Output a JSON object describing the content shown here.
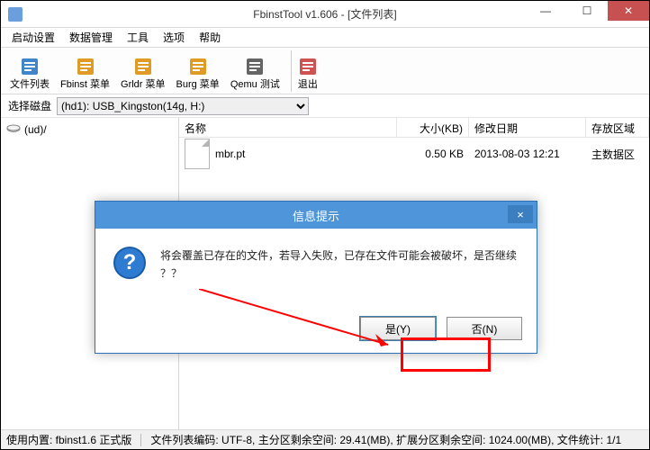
{
  "window": {
    "title": "FbinstTool v1.606 - [文件列表]"
  },
  "menu": {
    "items": [
      "启动设置",
      "数据管理",
      "工具",
      "选项",
      "帮助"
    ]
  },
  "toolbar": {
    "groups": [
      {
        "buttons": [
          {
            "label": "文件列表",
            "icon": "file-list-icon",
            "color": "#1e6fbf"
          },
          {
            "label": "Fbinst 菜单",
            "icon": "fbinst-menu-icon",
            "color": "#d98a00"
          },
          {
            "label": "Grldr 菜单",
            "icon": "grldr-menu-icon",
            "color": "#d98a00"
          },
          {
            "label": "Burg 菜单",
            "icon": "burg-menu-icon",
            "color": "#d98a00"
          },
          {
            "label": "Qemu 测试",
            "icon": "qemu-test-icon",
            "color": "#4a4a4a"
          }
        ]
      },
      {
        "buttons": [
          {
            "label": "退出",
            "icon": "exit-icon",
            "color": "#c73434"
          }
        ]
      }
    ]
  },
  "diskbar": {
    "label": "选择磁盘",
    "selected": "(hd1): USB_Kingston(14g, H:)"
  },
  "tree": {
    "root": "(ud)/"
  },
  "columns": {
    "name": "名称",
    "size": "大小(KB)",
    "date": "修改日期",
    "zone": "存放区域"
  },
  "files": [
    {
      "name": "mbr.pt",
      "size": "0.50 KB",
      "date": "2013-08-03 12:21",
      "zone": "主数据区"
    }
  ],
  "status": {
    "left": "使用内置: fbinst1.6 正式版",
    "right": "文件列表编码: UTF-8, 主分区剩余空间:   29.41(MB), 扩展分区剩余空间:   1024.00(MB), 文件统计: 1/1"
  },
  "dialog": {
    "title": "信息提示",
    "message": "将会覆盖已存在的文件，若导入失败，已存在文件可能会被破坏，是否继续 ？？",
    "yes": "是(Y)",
    "no": "否(N)",
    "close": "×"
  }
}
